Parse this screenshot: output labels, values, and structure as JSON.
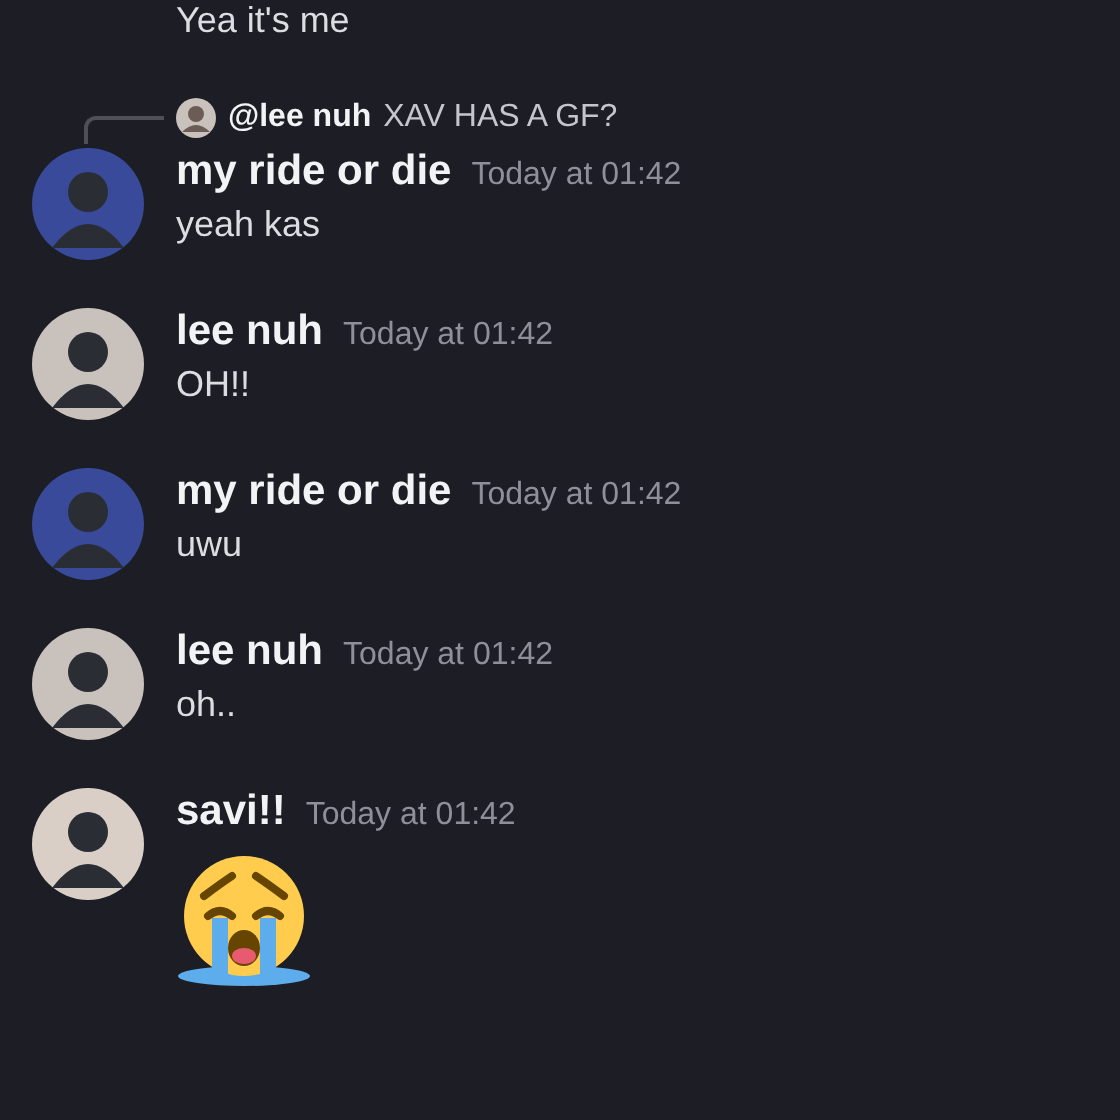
{
  "top_message": {
    "text": "Yea it's me"
  },
  "messages": [
    {
      "kind": "text",
      "author": "my ride or die",
      "time": "Today at 01:42",
      "body": "yeah kas",
      "reply": {
        "author": "@lee nuh",
        "text": "XAV HAS A GF?"
      }
    },
    {
      "kind": "text",
      "author": "lee nuh",
      "time": "Today at 01:42",
      "body": "OH!!"
    },
    {
      "kind": "text",
      "author": "my ride or die",
      "time": "Today at 01:42",
      "body": "uwu"
    },
    {
      "kind": "text",
      "author": "lee nuh",
      "time": "Today at 01:42",
      "body": "oh.."
    },
    {
      "kind": "emoji",
      "author": "savi!!",
      "time": "Today at 01:42"
    }
  ]
}
